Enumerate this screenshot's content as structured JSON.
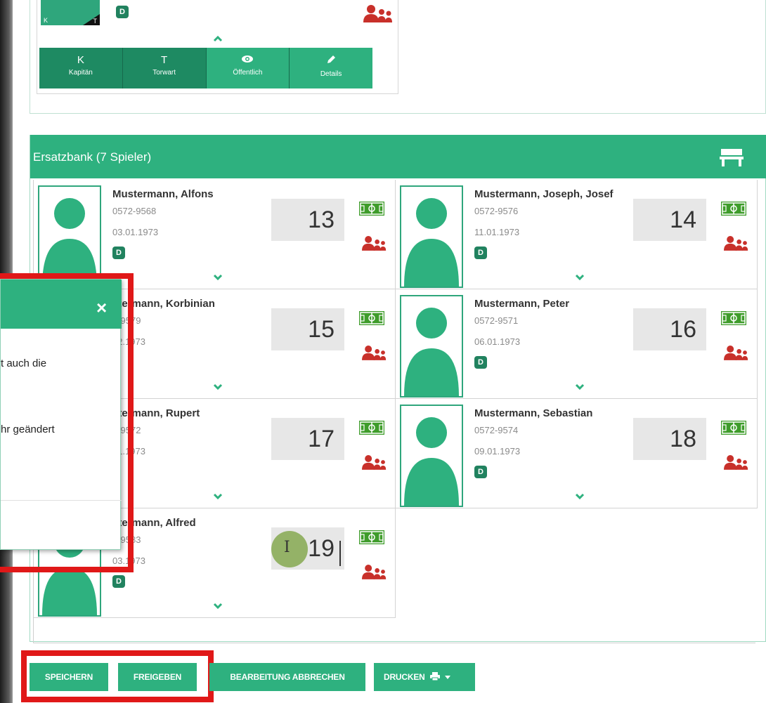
{
  "top_card": {
    "thumb_k": "K",
    "thumb_t": "T",
    "badge": "D",
    "buttons": [
      {
        "key": "K",
        "label": "Kapitän"
      },
      {
        "key": "T",
        "label": "Torwart"
      },
      {
        "key": "",
        "label": "Öffentlich",
        "icon": "eye-icon"
      },
      {
        "key": "",
        "label": "Details",
        "icon": "pencil-icon"
      }
    ]
  },
  "bench": {
    "title": "Ersatzbank (7 Spieler)",
    "icon": "bench-icon",
    "players": [
      {
        "name": "Mustermann, Alfons",
        "id": "0572-9568",
        "dob": "03.01.1973",
        "badge": "D",
        "number": "13"
      },
      {
        "name": "Mustermann, Joseph, Josef",
        "id": "0572-9576",
        "dob": "11.01.1973",
        "badge": "D",
        "number": "14"
      },
      {
        "name": "stermann, Korbinian",
        "id": "2-9579",
        "dob": "02.1973",
        "badge": "",
        "number": "15"
      },
      {
        "name": "Mustermann, Peter",
        "id": "0572-9571",
        "dob": "06.01.1973",
        "badge": "D",
        "number": "16"
      },
      {
        "name": "stermann, Rupert",
        "id": "2-9572",
        "dob": "01.1973",
        "badge": "",
        "number": "17"
      },
      {
        "name": "Mustermann, Sebastian",
        "id": "0572-9574",
        "dob": "09.01.1973",
        "badge": "D",
        "number": "18"
      },
      {
        "name": "stermann, Alfred",
        "id": "2-9583",
        "dob": "03.1973",
        "badge": "D",
        "number": "19"
      }
    ]
  },
  "modal": {
    "close": "×",
    "line1": "t auch die",
    "line2": "hr geändert"
  },
  "actions": {
    "save": "SPEICHERN",
    "release": "FREIGEBEN",
    "cancel": "BEARBEITUNG ABBRECHEN",
    "print": "DRUCKEN"
  },
  "colors": {
    "green": "#2eb17f",
    "dark_green": "#1e8a62",
    "red_group": "#c8302a",
    "highlight_red": "#e01818"
  }
}
